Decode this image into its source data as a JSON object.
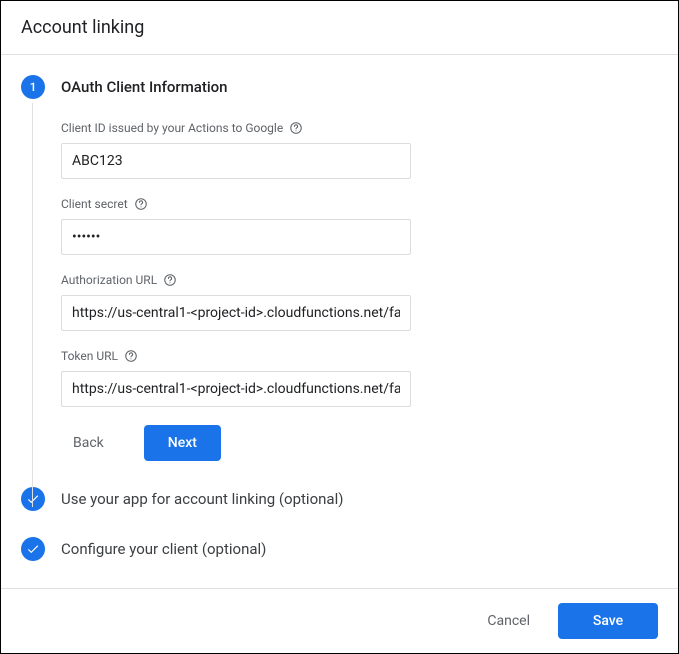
{
  "header": {
    "title": "Account linking"
  },
  "step1": {
    "number": "1",
    "title": "OAuth Client Information",
    "fields": {
      "client_id": {
        "label": "Client ID issued by your Actions to Google",
        "value": "ABC123"
      },
      "client_secret": {
        "label": "Client secret",
        "value": "••••••"
      },
      "auth_url": {
        "label": "Authorization URL",
        "value": "https://us-central1-<project-id>.cloudfunctions.net/fa"
      },
      "token_url": {
        "label": "Token URL",
        "value": "https://us-central1-<project-id>.cloudfunctions.net/fa"
      }
    },
    "buttons": {
      "back": "Back",
      "next": "Next"
    }
  },
  "step2": {
    "title": "Use your app for account linking (optional)"
  },
  "step3": {
    "title": "Configure your client (optional)"
  },
  "footer": {
    "cancel": "Cancel",
    "save": "Save"
  }
}
